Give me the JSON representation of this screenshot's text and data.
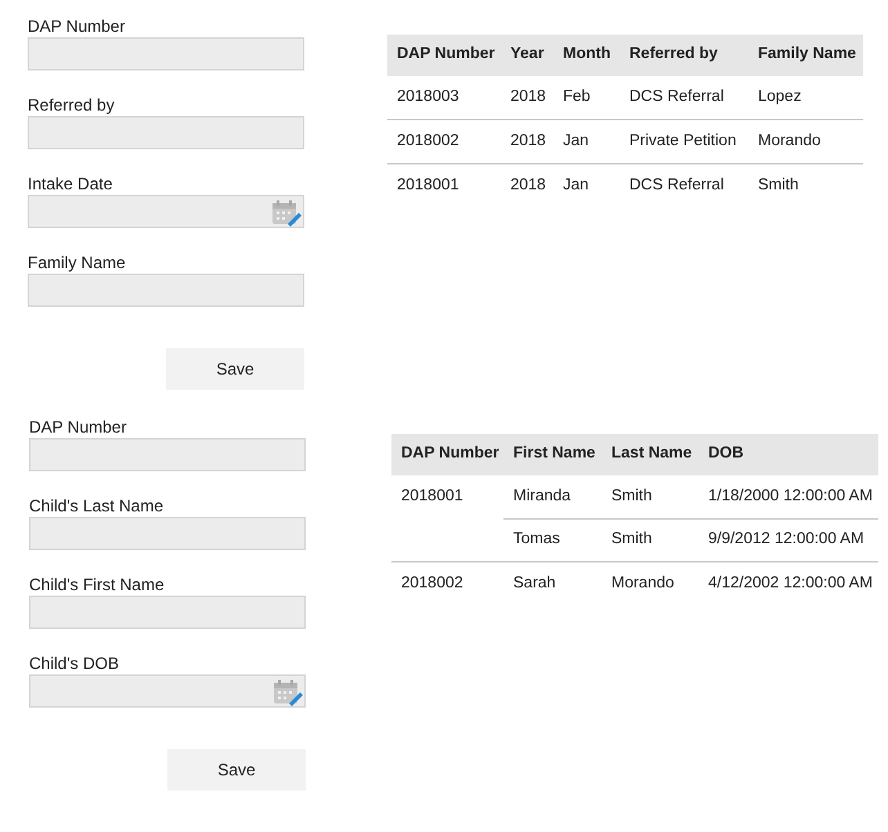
{
  "sections": [
    {
      "form": {
        "fields": [
          {
            "label": "DAP Number",
            "kind": "text"
          },
          {
            "label": "Referred by",
            "kind": "text"
          },
          {
            "label": "Intake Date",
            "kind": "date"
          },
          {
            "label": "Family Name",
            "kind": "text"
          }
        ],
        "button": "Save"
      },
      "table": {
        "columns": [
          "DAP Number",
          "Year",
          "Month",
          "Referred by",
          "Family Name"
        ],
        "rows": [
          {
            "cells": [
              "2018003",
              "2018",
              "Feb",
              "DCS Referral",
              "Lopez"
            ]
          },
          {
            "cells": [
              "2018002",
              "2018",
              "Jan",
              "Private Petition",
              "Morando"
            ]
          },
          {
            "cells": [
              "2018001",
              "2018",
              "Jan",
              "DCS Referral",
              "Smith"
            ]
          }
        ]
      }
    },
    {
      "form": {
        "fields": [
          {
            "label": "DAP Number",
            "kind": "text"
          },
          {
            "label": "Child's Last Name",
            "kind": "text"
          },
          {
            "label": "Child's First Name",
            "kind": "text"
          },
          {
            "label": "Child's DOB",
            "kind": "date"
          }
        ],
        "button": "Save"
      },
      "table": {
        "columns": [
          "DAP Number",
          "First Name",
          "Last Name",
          "DOB"
        ],
        "rows": [
          {
            "cells": [
              "2018001"
            ],
            "children": [
              {
                "cells": [
                  "Miranda",
                  "Smith",
                  "1/18/2000 12:00:00 AM"
                ]
              },
              {
                "cells": [
                  "Tomas",
                  "Smith",
                  "9/9/2012 12:00:00 AM"
                ]
              }
            ]
          },
          {
            "cells": [
              "2018002"
            ],
            "children": [
              {
                "cells": [
                  "Sarah",
                  "Morando",
                  "4/12/2002 12:00:00 AM"
                ]
              }
            ]
          }
        ]
      }
    }
  ]
}
